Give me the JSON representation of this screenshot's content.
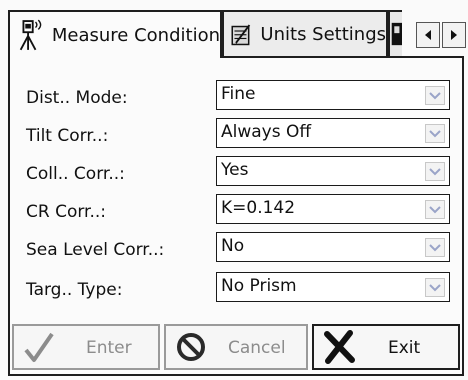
{
  "tabs": [
    {
      "label": "Measure Condition",
      "icon": "instrument-icon",
      "active": true
    },
    {
      "label": "Units Settings",
      "icon": "units-settings-icon",
      "active": false
    },
    {
      "label": "",
      "icon": "next-tab-icon",
      "active": false
    }
  ],
  "tab_scroll": {
    "left_icon": "arrow-left-icon",
    "right_icon": "arrow-right-icon"
  },
  "fields": [
    {
      "label": "Dist.. Mode:",
      "value": "Fine"
    },
    {
      "label": "Tilt Corr..:",
      "value": "Always Off"
    },
    {
      "label": "Coll.. Corr..:",
      "value": "Yes"
    },
    {
      "label": "CR Corr..:",
      "value": "K=0.142"
    },
    {
      "label": "Sea Level Corr..:",
      "value": "No"
    },
    {
      "label": "Targ.. Type:",
      "value": "No Prism"
    }
  ],
  "buttons": {
    "enter": {
      "label": "Enter",
      "enabled": false,
      "icon": "checkmark-icon"
    },
    "cancel": {
      "label": "Cancel",
      "enabled": false,
      "icon": "no-symbol-icon"
    },
    "exit": {
      "label": "Exit",
      "enabled": true,
      "icon": "x-mark-icon"
    }
  },
  "colors": {
    "border": "#1e1e1e",
    "disabled_text": "#8c8c8c",
    "dropdown_arrow": "#9aa4c8"
  }
}
